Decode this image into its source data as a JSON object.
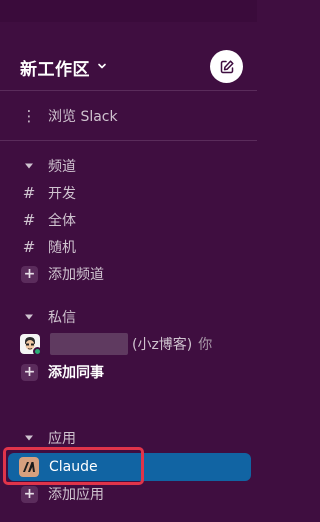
{
  "workspace": {
    "name": "新工作区",
    "chevron_icon": "chevron-down-icon",
    "compose_icon": "compose-icon"
  },
  "browse": {
    "icon": "vertical-ellipsis-icon",
    "label": "浏览 Slack"
  },
  "channels": {
    "header": "频道",
    "items": [
      {
        "icon": "hash-icon",
        "label": "开发"
      },
      {
        "icon": "hash-icon",
        "label": "全体"
      },
      {
        "icon": "hash-icon",
        "label": "随机"
      }
    ],
    "add_label": "添加频道"
  },
  "direct_messages": {
    "header": "私信",
    "self": {
      "suffix": "(小z博客)",
      "you_label": "你",
      "presence": "active"
    },
    "add_label": "添加同事"
  },
  "apps": {
    "header": "应用",
    "items": [
      {
        "label": "Claude",
        "selected": true,
        "icon": "claude-logo-icon"
      }
    ],
    "add_label": "添加应用"
  },
  "colors": {
    "sidebar_bg": "#3f0e40",
    "selected_bg": "#1164a3",
    "highlight": "#e0344a",
    "presence": "#2bac76"
  }
}
